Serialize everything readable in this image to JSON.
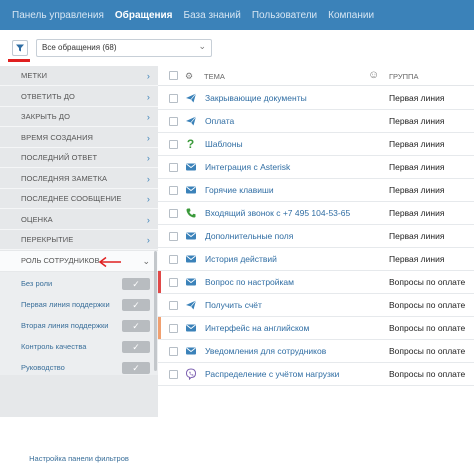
{
  "topnav": {
    "items": [
      {
        "label": "Панель управления",
        "active": false
      },
      {
        "label": "Обращения",
        "active": true
      },
      {
        "label": "База знаний",
        "active": false
      },
      {
        "label": "Пользователи",
        "active": false
      },
      {
        "label": "Компании",
        "active": false
      }
    ]
  },
  "toolbar": {
    "filter_icon": "filter-icon",
    "select_value": "Все обращения (68)"
  },
  "sidebar": {
    "filters": [
      "Метки",
      "Ответить до",
      "Закрыть до",
      "Время создания",
      "Последний ответ",
      "Последняя заметка",
      "Последнее сообщение",
      "Оценка",
      "Перекрытие"
    ],
    "role_header": "Роль сотрудников",
    "roles": [
      "Без роли",
      "Первая линия поддержки",
      "Вторая линия поддержки",
      "Контроль качества",
      "Руководство"
    ],
    "settings_link": "Настройка панели фильтров"
  },
  "table": {
    "header_theme": "Тема",
    "header_group": "Группа",
    "rows": [
      {
        "icon": "paper-plane-icon",
        "subject": "Закрывающие документы",
        "group": "Первая линия"
      },
      {
        "icon": "paper-plane-icon",
        "subject": "Оплата",
        "group": "Первая линия"
      },
      {
        "icon": "question-icon",
        "subject": "Шаблоны",
        "group": "Первая линия"
      },
      {
        "icon": "envelope-icon",
        "subject": "Интеграция с Asterisk",
        "group": "Первая линия"
      },
      {
        "icon": "envelope-icon",
        "subject": "Горячие клавиши",
        "group": "Первая линия"
      },
      {
        "icon": "phone-icon",
        "subject": "Входящий звонок с +7 495 104-53-65",
        "group": "Первая линия"
      },
      {
        "icon": "envelope-icon",
        "subject": "Дополнительные поля",
        "group": "Первая линия"
      },
      {
        "icon": "envelope-icon",
        "subject": "История действий",
        "group": "Первая линия"
      },
      {
        "icon": "envelope-icon",
        "subject": "Вопрос по настройкам",
        "group": "Вопросы по оплате"
      },
      {
        "icon": "paper-plane-icon",
        "subject": "Получить счёт",
        "group": "Вопросы по оплате"
      },
      {
        "icon": "envelope-icon",
        "subject": "Интерфейс на английском",
        "group": "Вопросы по оплате"
      },
      {
        "icon": "envelope-icon",
        "subject": "Уведомления для сотрудников",
        "group": "Вопросы по оплате"
      },
      {
        "icon": "viber-icon",
        "subject": "Распределение с учётом нагрузки",
        "group": "Вопросы по оплате"
      }
    ]
  },
  "colors": {
    "nav_bg": "#3b82b9",
    "link": "#2f6da3",
    "red_marker": "#e04848",
    "orange_marker": "#f0a070",
    "phone": "#3b9a3b",
    "question": "#3b9a3b",
    "viber": "#7b5fb0"
  }
}
